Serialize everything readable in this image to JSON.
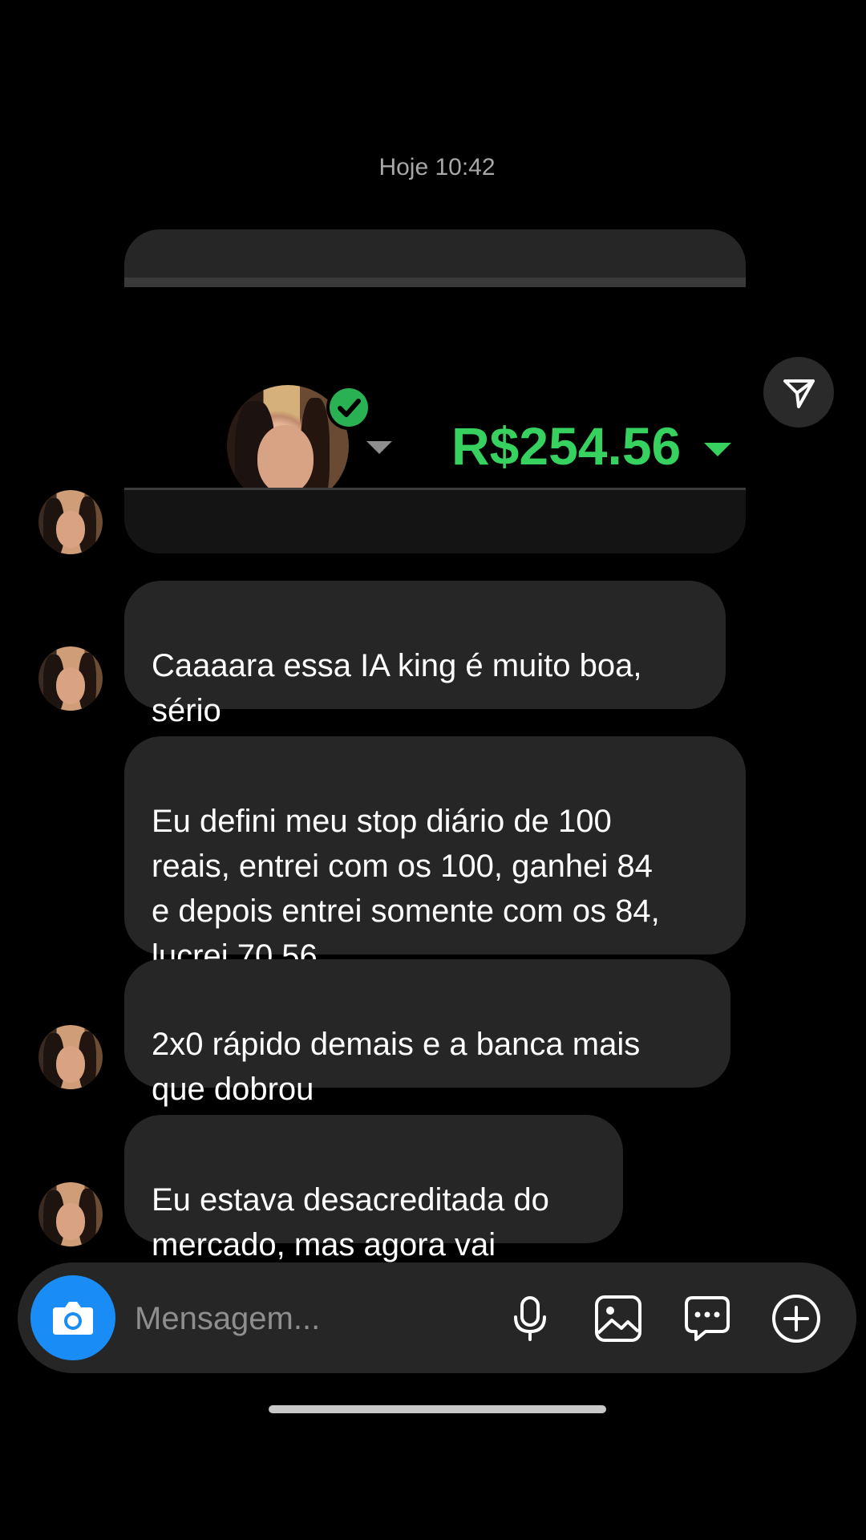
{
  "header": {
    "timestamp": "Hoje 10:42"
  },
  "shared_post": {
    "balance": "R$254.56",
    "verified": true
  },
  "messages": [
    {
      "text": "Caaaara essa IA king é muito boa,\nsério"
    },
    {
      "text": "Eu defini meu stop diário de 100\nreais, entrei com os 100, ganhei 84\ne depois entrei somente com os 84,\nlucrei 70,56"
    },
    {
      "text": "2x0 rápido demais e a banca mais\nque dobrou",
      "emoji": "😍"
    },
    {
      "text": "Eu estava desacreditada do\nmercado, mas agora vai",
      "emoji": "🙌"
    }
  ],
  "composer": {
    "placeholder": "Mensagem..."
  },
  "colors": {
    "background": "#000000",
    "bubble": "#262626",
    "balance_green": "#37d15f",
    "camera_blue": "#1a8cf5",
    "verified_green": "#29b154"
  },
  "icons": {
    "camera": "camera-icon",
    "microphone": "microphone-icon",
    "gallery": "gallery-icon",
    "sticker": "chat-bubble-icon",
    "add": "plus-circle-icon",
    "share": "paper-plane-icon"
  }
}
